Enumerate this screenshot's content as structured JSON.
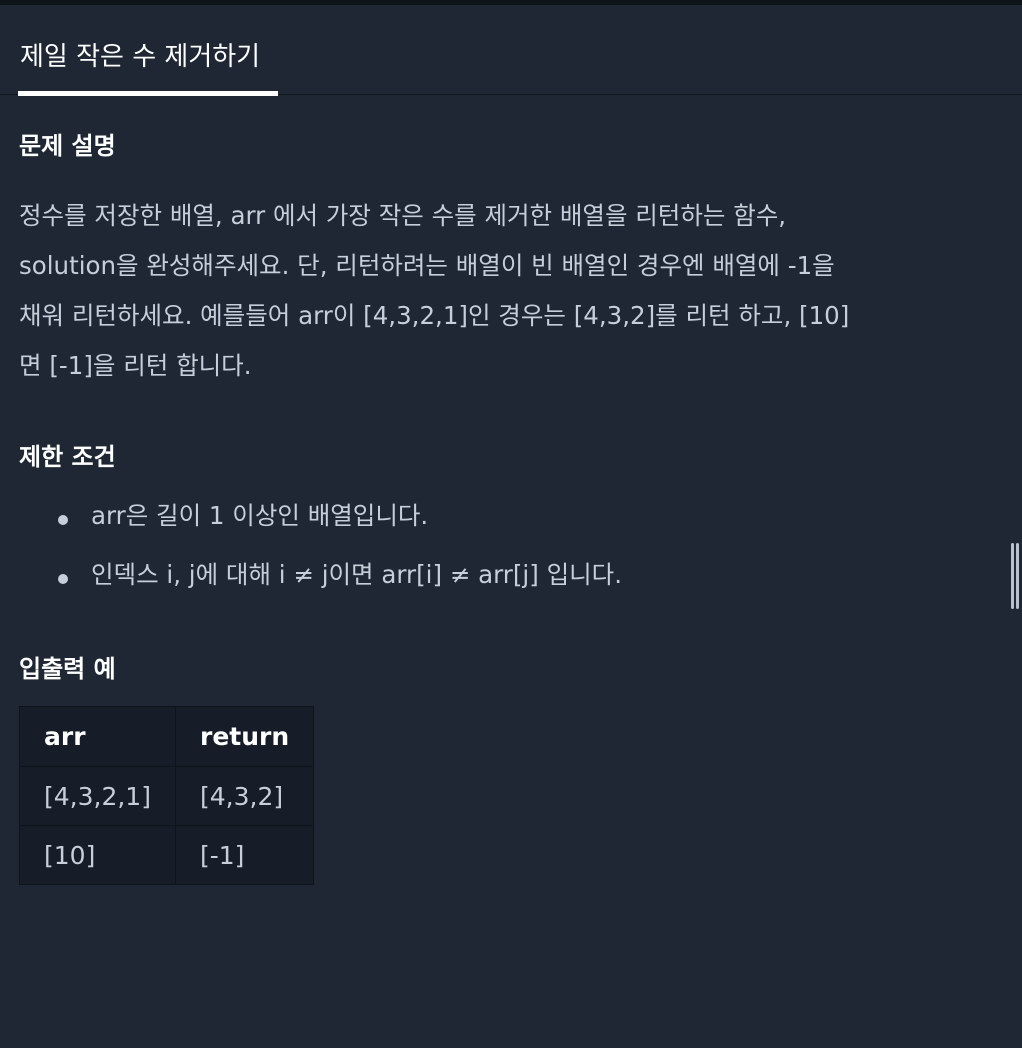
{
  "tab": {
    "title": "제일 작은 수 제거하기"
  },
  "sections": {
    "description_title": "문제 설명",
    "description_lines": [
      "정수를 저장한 배열, arr 에서 가장 작은 수를 제거한 배열을 리턴하는 함수,",
      "solution을 완성해주세요. 단, 리턴하려는 배열이 빈 배열인 경우엔 배열에 -1을",
      "채워 리턴하세요. 예를들어 arr이 [4,3,2,1]인 경우는 [4,3,2]를 리턴 하고, [10]",
      "면 [-1]을 리턴 합니다."
    ],
    "constraints_title": "제한 조건",
    "constraints": [
      "arr은 길이 1 이상인 배열입니다.",
      "인덱스 i, j에 대해 i ≠ j이면 arr[i] ≠ arr[j] 입니다."
    ],
    "examples_title": "입출력 예"
  },
  "examples_table": {
    "headers": [
      "arr",
      "return"
    ],
    "rows": [
      [
        "[4,3,2,1]",
        "[4,3,2]"
      ],
      [
        "[10]",
        "[-1]"
      ]
    ]
  }
}
